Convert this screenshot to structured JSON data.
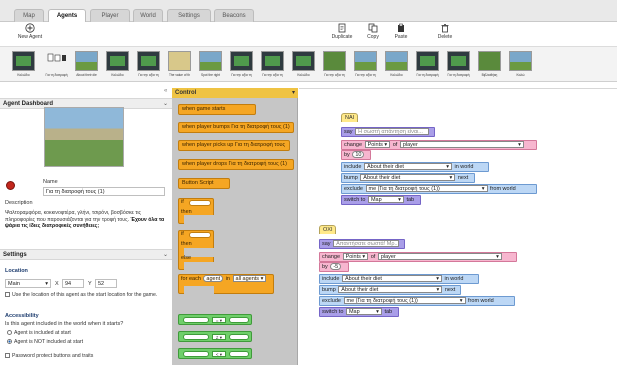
{
  "tabs": [
    "Map",
    "Agents",
    "Player",
    "World",
    "Settings",
    "Beacons"
  ],
  "toolbar": {
    "new_agent": "New Agent",
    "duplicate": "Duplicate",
    "copy": "Copy",
    "paste": "Paste",
    "delete": "Delete"
  },
  "thumbnails": [
    "Καλώδιο",
    "Για τη διατροφή",
    "About their die",
    "Καλώδιο",
    "Για την αξία τη",
    "The value of th",
    "Spot the right",
    "Για την αξία τη",
    "Για την αξία τη",
    "Καλώδιο",
    "Για την αξία τη",
    "Για την αξία τη",
    "Καλώδιο",
    "Για τη διατροφή",
    "Για τη διατροφή",
    "Βιβλιοθήκη",
    "Καλώ"
  ],
  "dashboard": {
    "title": "Agent Dashboard",
    "name_label": "Name",
    "name_value": "Για τη διατροφή τους (1)",
    "description_label": "Description",
    "description_text": "Ψαλτοραμφόρα, κοκκινοφτέρα, γλήνι, τσιρόνι, βοσβόσκε τις πληροφορίες που παρουσιάζονται για την τροφή τους.",
    "description_bold": "Έχουν όλα τα ψάρια τις ίδιες διατροφικές συνήθειες;",
    "settings_title": "Settings",
    "location_title": "Location",
    "map_select": "Main",
    "x_label": "X",
    "x_value": "94",
    "y_label": "Y",
    "y_value": "52",
    "use_location_text": "Use the location of this agent as the start location for the game.",
    "accessibility_title": "Accessibility",
    "included_question": "Is this agent included in the world when it starts?",
    "included_option": "Agent is included at start",
    "not_included_option": "Agent is NOT included at start",
    "password_option": "Password protect buttons and traits"
  },
  "palette": {
    "title": "Control",
    "blocks": [
      "when game starts",
      "when player bumps Για τη διατροφή τους (1)",
      "when player picks up Για τη διατροφή τους",
      "when player drops Για τη διατροφή τους (1)",
      "Button Script"
    ],
    "if_label": "if",
    "then_label": "then",
    "else_label": "else",
    "for_each_label": "for each",
    "for_each_var": "agent",
    "for_each_in": "in",
    "for_each_set": "all agents",
    "op_eq": "= ▾",
    "op_ne": "≠ ▾",
    "op_lt": "< ▾"
  },
  "scripts": [
    {
      "hat": "NAI",
      "say_label": "say",
      "say_text": "Η σωστή απάντηση είναι...",
      "change_label": "change",
      "change_trait": "Points",
      "of_label": "of",
      "of_target": "player",
      "by_label": "by",
      "by_value": "10",
      "include_label": "include",
      "include_value": "About their diet",
      "include_suffix": "in world",
      "bump_label": "bump",
      "bump_value": "About their diet",
      "bump_suffix": "next",
      "exclude_label": "exclude",
      "exclude_value": "me (Για τη διατροφή τους (1))",
      "exclude_suffix": "from world",
      "switch_label": "switch to",
      "switch_value": "Map",
      "switch_suffix": "tab"
    },
    {
      "hat": "ΟΧΙ",
      "say_label": "say",
      "say_text": "Απαντήσατε σωστά! Μρ...",
      "change_label": "change",
      "change_trait": "Points",
      "of_label": "of",
      "of_target": "player",
      "by_label": "by",
      "by_value": "-5",
      "include_label": "include",
      "include_value": "About their diet",
      "include_suffix": "in world",
      "bump_label": "bump",
      "bump_value": "About their diet",
      "bump_suffix": "next",
      "exclude_label": "exclude",
      "exclude_value": "me (Για τη διατροφή τους (1))",
      "exclude_suffix": "from world",
      "switch_label": "switch to",
      "switch_value": "Map",
      "switch_suffix": "tab"
    }
  ]
}
